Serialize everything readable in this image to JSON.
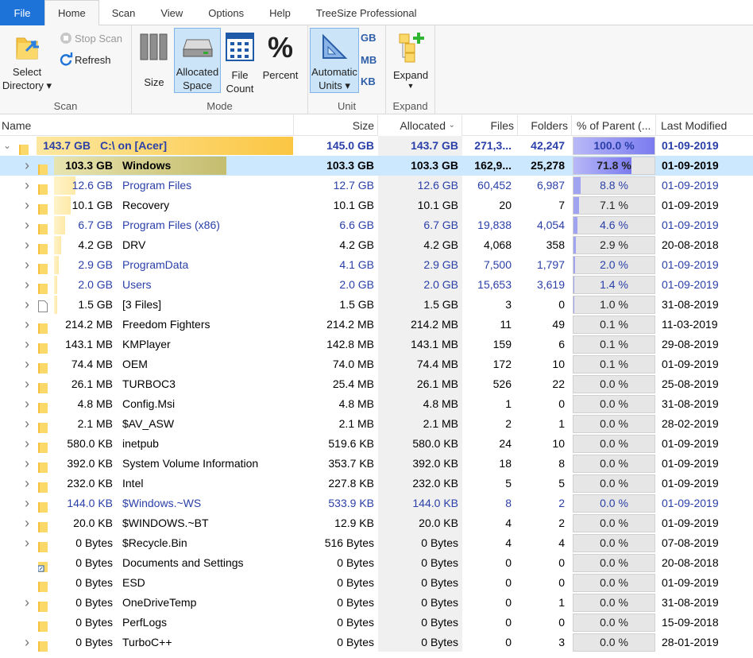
{
  "menu": {
    "items": [
      "File",
      "Home",
      "Scan",
      "View",
      "Options",
      "Help",
      "TreeSize Professional"
    ]
  },
  "ribbon": {
    "scan": {
      "select_directory": "Select Directory ▾",
      "stop_scan": "Stop Scan",
      "refresh": "Refresh",
      "label": "Scan"
    },
    "mode": {
      "size": "Size",
      "allocated_space": "Allocated Space",
      "file_count": "File Count",
      "percent": "Percent",
      "label": "Mode"
    },
    "unit": {
      "automatic_units": "Automatic Units ▾",
      "gb": "GB",
      "mb": "MB",
      "kb": "KB",
      "label": "Unit"
    },
    "expand": {
      "expand": "Expand",
      "label": "Expand"
    }
  },
  "columns": {
    "name": "Name",
    "size": "Size",
    "allocated": "Allocated",
    "files": "Files",
    "folders": "Folders",
    "percent": "% of Parent (...",
    "modified": "Last Modified"
  },
  "colors": {
    "bar_root": "#fbc642",
    "bar_selected": "#c4bd6e",
    "pct_fill": "#7b7bf0",
    "selected_row": "#cce8ff",
    "link_blue": "#2a3fa8"
  },
  "rows": [
    {
      "level": 0,
      "expander": "open",
      "icon": "folder",
      "sizeLabel": "143.7 GB",
      "name": "C:\\  on  [Acer]",
      "size": "145.0 GB",
      "alloc": "143.7 GB",
      "files": "271,3...",
      "folders": "42,247",
      "pct": "100.0 %",
      "pctVal": 100,
      "modified": "01-09-2019",
      "bold": true,
      "blue": true,
      "barFrac": 1.0
    },
    {
      "level": 1,
      "expander": "closed",
      "icon": "folder",
      "sizeLabel": "103.3 GB",
      "name": "Windows",
      "size": "103.3 GB",
      "alloc": "103.3 GB",
      "files": "162,9...",
      "folders": "25,278",
      "pct": "71.8 %",
      "pctVal": 71.8,
      "modified": "01-09-2019",
      "bold": true,
      "blue": false,
      "barFrac": 0.718,
      "selected": true
    },
    {
      "level": 1,
      "expander": "closed",
      "icon": "folder",
      "sizeLabel": "12.6 GB",
      "name": "Program Files",
      "size": "12.7 GB",
      "alloc": "12.6 GB",
      "files": "60,452",
      "folders": "6,987",
      "pct": "8.8 %",
      "pctVal": 8.8,
      "modified": "01-09-2019",
      "blue": true,
      "barFrac": 0.088
    },
    {
      "level": 1,
      "expander": "closed",
      "icon": "folder",
      "sizeLabel": "10.1 GB",
      "name": "Recovery",
      "size": "10.1 GB",
      "alloc": "10.1 GB",
      "files": "20",
      "folders": "7",
      "pct": "7.1 %",
      "pctVal": 7.1,
      "modified": "01-09-2019",
      "barFrac": 0.071
    },
    {
      "level": 1,
      "expander": "closed",
      "icon": "folder",
      "sizeLabel": "6.7 GB",
      "name": "Program Files (x86)",
      "size": "6.6 GB",
      "alloc": "6.7 GB",
      "files": "19,838",
      "folders": "4,054",
      "pct": "4.6 %",
      "pctVal": 4.6,
      "modified": "01-09-2019",
      "blue": true,
      "barFrac": 0.046
    },
    {
      "level": 1,
      "expander": "closed",
      "icon": "folder",
      "sizeLabel": "4.2 GB",
      "name": "DRV",
      "size": "4.2 GB",
      "alloc": "4.2 GB",
      "files": "4,068",
      "folders": "358",
      "pct": "2.9 %",
      "pctVal": 2.9,
      "modified": "20-08-2018",
      "barFrac": 0.029
    },
    {
      "level": 1,
      "expander": "closed",
      "icon": "folder",
      "sizeLabel": "2.9 GB",
      "name": "ProgramData",
      "size": "4.1 GB",
      "alloc": "2.9 GB",
      "files": "7,500",
      "folders": "1,797",
      "pct": "2.0 %",
      "pctVal": 2.0,
      "modified": "01-09-2019",
      "blue": true,
      "barFrac": 0.02
    },
    {
      "level": 1,
      "expander": "closed",
      "icon": "folder",
      "sizeLabel": "2.0 GB",
      "name": "Users",
      "size": "2.0 GB",
      "alloc": "2.0 GB",
      "files": "15,653",
      "folders": "3,619",
      "pct": "1.4 %",
      "pctVal": 1.4,
      "modified": "01-09-2019",
      "blue": true,
      "barFrac": 0.014
    },
    {
      "level": 1,
      "expander": "closed",
      "icon": "file",
      "sizeLabel": "1.5 GB",
      "name": "[3 Files]",
      "size": "1.5 GB",
      "alloc": "1.5 GB",
      "files": "3",
      "folders": "0",
      "pct": "1.0 %",
      "pctVal": 1.0,
      "modified": "31-08-2019",
      "barFrac": 0.01
    },
    {
      "level": 1,
      "expander": "closed",
      "icon": "folder",
      "sizeLabel": "214.2 MB",
      "name": "Freedom Fighters",
      "size": "214.2 MB",
      "alloc": "214.2 MB",
      "files": "11",
      "folders": "49",
      "pct": "0.1 %",
      "pctVal": 0.1,
      "modified": "11-03-2019",
      "barFrac": 0
    },
    {
      "level": 1,
      "expander": "closed",
      "icon": "folder",
      "sizeLabel": "143.1 MB",
      "name": "KMPlayer",
      "size": "142.8 MB",
      "alloc": "143.1 MB",
      "files": "159",
      "folders": "6",
      "pct": "0.1 %",
      "pctVal": 0.1,
      "modified": "29-08-2019",
      "barFrac": 0
    },
    {
      "level": 1,
      "expander": "closed",
      "icon": "folder",
      "sizeLabel": "74.4 MB",
      "name": "OEM",
      "size": "74.0 MB",
      "alloc": "74.4 MB",
      "files": "172",
      "folders": "10",
      "pct": "0.1 %",
      "pctVal": 0.1,
      "modified": "01-09-2019",
      "barFrac": 0
    },
    {
      "level": 1,
      "expander": "closed",
      "icon": "folder",
      "sizeLabel": "26.1 MB",
      "name": "TURBOC3",
      "size": "25.4 MB",
      "alloc": "26.1 MB",
      "files": "526",
      "folders": "22",
      "pct": "0.0 %",
      "pctVal": 0,
      "modified": "25-08-2019",
      "barFrac": 0
    },
    {
      "level": 1,
      "expander": "closed",
      "icon": "folder",
      "sizeLabel": "4.8 MB",
      "name": "Config.Msi",
      "size": "4.8 MB",
      "alloc": "4.8 MB",
      "files": "1",
      "folders": "0",
      "pct": "0.0 %",
      "pctVal": 0,
      "modified": "31-08-2019",
      "barFrac": 0
    },
    {
      "level": 1,
      "expander": "closed",
      "icon": "folder",
      "sizeLabel": "2.1 MB",
      "name": "$AV_ASW",
      "size": "2.1 MB",
      "alloc": "2.1 MB",
      "files": "2",
      "folders": "1",
      "pct": "0.0 %",
      "pctVal": 0,
      "modified": "28-02-2019",
      "barFrac": 0
    },
    {
      "level": 1,
      "expander": "closed",
      "icon": "folder",
      "sizeLabel": "580.0 KB",
      "name": "inetpub",
      "size": "519.6 KB",
      "alloc": "580.0 KB",
      "files": "24",
      "folders": "10",
      "pct": "0.0 %",
      "pctVal": 0,
      "modified": "01-09-2019",
      "barFrac": 0
    },
    {
      "level": 1,
      "expander": "closed",
      "icon": "folder",
      "sizeLabel": "392.0 KB",
      "name": "System Volume Information",
      "size": "353.7 KB",
      "alloc": "392.0 KB",
      "files": "18",
      "folders": "8",
      "pct": "0.0 %",
      "pctVal": 0,
      "modified": "01-09-2019",
      "barFrac": 0
    },
    {
      "level": 1,
      "expander": "closed",
      "icon": "folder",
      "sizeLabel": "232.0 KB",
      "name": "Intel",
      "size": "227.8 KB",
      "alloc": "232.0 KB",
      "files": "5",
      "folders": "5",
      "pct": "0.0 %",
      "pctVal": 0,
      "modified": "01-09-2019",
      "barFrac": 0
    },
    {
      "level": 1,
      "expander": "closed",
      "icon": "folder",
      "sizeLabel": "144.0 KB",
      "name": "$Windows.~WS",
      "size": "533.9 KB",
      "alloc": "144.0 KB",
      "files": "8",
      "folders": "2",
      "pct": "0.0 %",
      "pctVal": 0,
      "modified": "01-09-2019",
      "blue": true,
      "barFrac": 0
    },
    {
      "level": 1,
      "expander": "closed",
      "icon": "folder",
      "sizeLabel": "20.0 KB",
      "name": "$WINDOWS.~BT",
      "size": "12.9 KB",
      "alloc": "20.0 KB",
      "files": "4",
      "folders": "2",
      "pct": "0.0 %",
      "pctVal": 0,
      "modified": "01-09-2019",
      "barFrac": 0
    },
    {
      "level": 1,
      "expander": "closed",
      "icon": "folder",
      "sizeLabel": "0 Bytes",
      "name": "$Recycle.Bin",
      "size": "516 Bytes",
      "alloc": "0 Bytes",
      "files": "4",
      "folders": "4",
      "pct": "0.0 %",
      "pctVal": 0,
      "modified": "07-08-2019",
      "barFrac": 0
    },
    {
      "level": 1,
      "expander": "none",
      "icon": "shortcut",
      "sizeLabel": "0 Bytes",
      "name": "Documents and Settings",
      "size": "0 Bytes",
      "alloc": "0 Bytes",
      "files": "0",
      "folders": "0",
      "pct": "0.0 %",
      "pctVal": 0,
      "modified": "20-08-2018",
      "barFrac": 0
    },
    {
      "level": 1,
      "expander": "none",
      "icon": "folder",
      "sizeLabel": "0 Bytes",
      "name": "ESD",
      "size": "0 Bytes",
      "alloc": "0 Bytes",
      "files": "0",
      "folders": "0",
      "pct": "0.0 %",
      "pctVal": 0,
      "modified": "01-09-2019",
      "barFrac": 0
    },
    {
      "level": 1,
      "expander": "closed",
      "icon": "folder",
      "sizeLabel": "0 Bytes",
      "name": "OneDriveTemp",
      "size": "0 Bytes",
      "alloc": "0 Bytes",
      "files": "0",
      "folders": "1",
      "pct": "0.0 %",
      "pctVal": 0,
      "modified": "31-08-2019",
      "barFrac": 0
    },
    {
      "level": 1,
      "expander": "none",
      "icon": "folder",
      "sizeLabel": "0 Bytes",
      "name": "PerfLogs",
      "size": "0 Bytes",
      "alloc": "0 Bytes",
      "files": "0",
      "folders": "0",
      "pct": "0.0 %",
      "pctVal": 0,
      "modified": "15-09-2018",
      "barFrac": 0
    },
    {
      "level": 1,
      "expander": "closed",
      "icon": "folder",
      "sizeLabel": "0 Bytes",
      "name": "TurboC++",
      "size": "0 Bytes",
      "alloc": "0 Bytes",
      "files": "0",
      "folders": "3",
      "pct": "0.0 %",
      "pctVal": 0,
      "modified": "28-01-2019",
      "barFrac": 0
    }
  ]
}
